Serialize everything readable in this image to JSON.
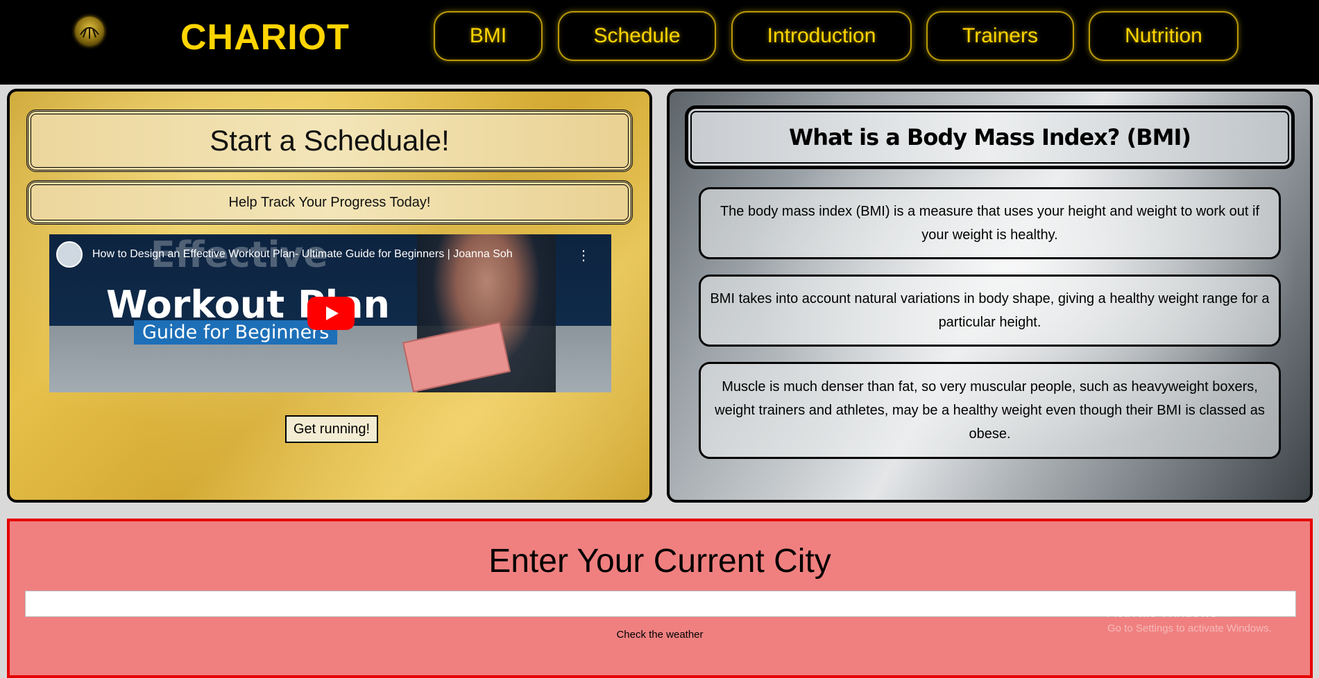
{
  "header": {
    "brand": "CHARIOT",
    "nav": [
      "BMI",
      "Schedule",
      "Introduction",
      "Trainers",
      "Nutrition"
    ]
  },
  "schedule_panel": {
    "title": "Start a Scheduale!",
    "subtitle": "Help Track Your Progress Today!",
    "video": {
      "title": "How to Design an Effective Workout Plan- Ultimate Guide for Beginners | Joanna Soh",
      "thumbnail_ghost": "Effective",
      "thumbnail_heading": "Workout Plan",
      "thumbnail_sub": "Guide for Beginners",
      "more_icon": "⋮"
    },
    "button_label": "Get running!"
  },
  "bmi_panel": {
    "title": "What is a Body Mass Index? (BMI)",
    "paragraphs": [
      "The body mass index (BMI) is a measure that uses your height and weight to work out if your weight is healthy.",
      "BMI takes into account natural variations in body shape, giving a healthy weight range for a particular height.",
      "Muscle is much denser than fat, so very muscular people, such as heavyweight boxers, weight trainers and athletes, may be a healthy weight even though their BMI is classed as obese."
    ]
  },
  "weather": {
    "title": "Enter Your Current City",
    "input_value": "",
    "button_label": "Check the weather"
  },
  "os_overlay": {
    "line1": "Activate Windows",
    "line2": "Go to Settings to activate Windows."
  },
  "colors": {
    "header_bg": "#000000",
    "accent": "#ffd500",
    "weather_bg": "#f08080",
    "weather_border": "#e60000"
  }
}
